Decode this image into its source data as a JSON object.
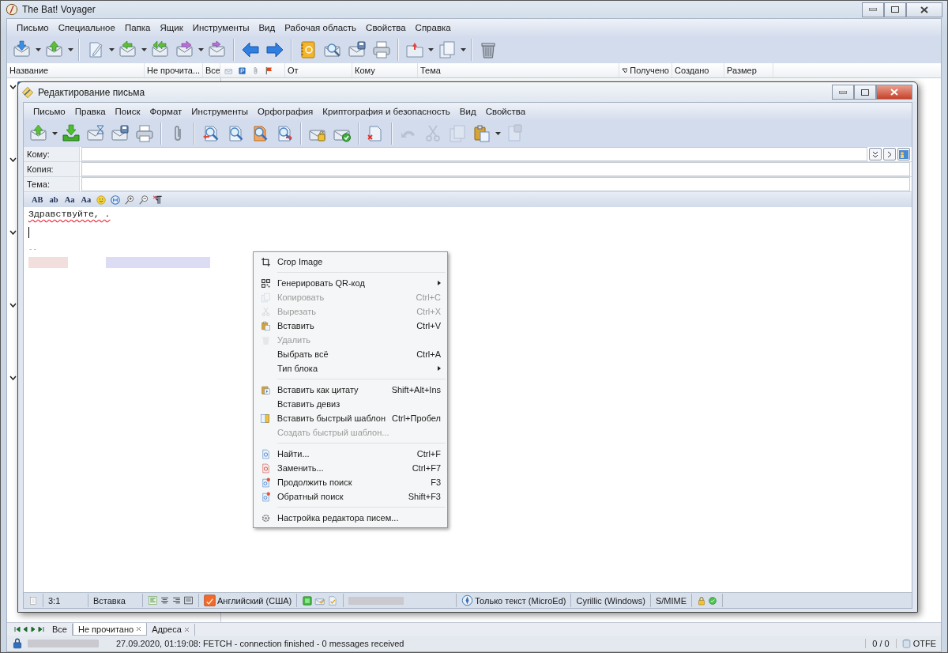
{
  "main_window": {
    "title": "The Bat! Voyager",
    "menu": [
      "Письмо",
      "Специальное",
      "Папка",
      "Ящик",
      "Инструменты",
      "Вид",
      "Рабочая область",
      "Свойства",
      "Справка"
    ],
    "pane_columns": [
      {
        "label": "Название"
      },
      {
        "label": "Не прочита..."
      },
      {
        "label": "Все"
      }
    ],
    "list_columns": [
      {
        "label": "От",
        "sorted": false
      },
      {
        "label": "Кому",
        "sorted": false
      },
      {
        "label": "Тема",
        "sorted": false
      },
      {
        "label": "Получено",
        "sorted": true
      },
      {
        "label": "Создано",
        "sorted": false
      },
      {
        "label": "Размер",
        "sorted": false
      }
    ],
    "tabs": [
      {
        "label": "Все",
        "selected": false,
        "closable": false
      },
      {
        "label": "Не прочитано",
        "selected": true,
        "closable": true
      },
      {
        "label": "Адреса",
        "selected": false,
        "closable": true
      }
    ],
    "status": {
      "message": "27.09.2020, 01:19:08: FETCH - connection finished - 0 messages received",
      "counter": "0 / 0",
      "mode": "OTFE"
    }
  },
  "editor": {
    "title": "Редактирование письма",
    "menu": [
      "Письмо",
      "Правка",
      "Поиск",
      "Формат",
      "Инструменты",
      "Орфография",
      "Криптография и безопасность",
      "Вид",
      "Свойства"
    ],
    "toolbar": [
      {
        "disabled": false
      },
      {
        "disabled": false
      },
      {
        "disabled": false
      },
      {
        "disabled": false
      },
      {
        "disabled": false
      },
      {
        "disabled": false
      },
      {
        "disabled": false
      },
      {
        "disabled": false
      },
      {
        "disabled": false
      },
      {
        "disabled": false
      },
      {
        "disabled": false
      },
      {
        "disabled": false
      },
      {
        "disabled": false
      },
      {
        "disabled": true
      },
      {
        "disabled": true
      },
      {
        "disabled": true
      },
      {
        "disabled": false
      },
      {
        "disabled": true
      }
    ],
    "fields": [
      {
        "label": "Кому:"
      },
      {
        "label": "Копия:"
      },
      {
        "label": "Тема:"
      }
    ],
    "format_buttons": [
      "AB",
      "ab",
      "Aa",
      "Aa"
    ],
    "body": {
      "greeting": "Здравствуйте, .",
      "signature_separator": "--"
    },
    "status": {
      "position": "3:1",
      "mode": "Вставка",
      "language": "Английский (США)",
      "editor_type": "Только текст (MicroEd)",
      "charset": "Cyrillic (Windows)",
      "security": "S/MIME"
    }
  },
  "context_menu": [
    {
      "kind": "item",
      "label": "Crop Image",
      "disabled": false,
      "submenu": false
    },
    {
      "kind": "separator"
    },
    {
      "kind": "item",
      "label": "Генерировать QR-код",
      "disabled": false,
      "submenu": true
    },
    {
      "kind": "item",
      "label": "Копировать",
      "shortcut": "Ctrl+C",
      "disabled": true,
      "submenu": false
    },
    {
      "kind": "item",
      "label": "Вырезать",
      "shortcut": "Ctrl+X",
      "disabled": true,
      "submenu": false
    },
    {
      "kind": "item",
      "label": "Вставить",
      "shortcut": "Ctrl+V",
      "disabled": false,
      "submenu": false
    },
    {
      "kind": "item",
      "label": "Удалить",
      "disabled": true,
      "submenu": false
    },
    {
      "kind": "item",
      "label": "Выбрать всё",
      "shortcut": "Ctrl+A",
      "disabled": false,
      "submenu": false
    },
    {
      "kind": "item",
      "label": "Тип блока",
      "disabled": false,
      "submenu": true
    },
    {
      "kind": "separator"
    },
    {
      "kind": "item",
      "label": "Вставить как цитату",
      "shortcut": "Shift+Alt+Ins",
      "disabled": false,
      "submenu": false
    },
    {
      "kind": "item",
      "label": "Вставить девиз",
      "disabled": false,
      "submenu": false
    },
    {
      "kind": "item",
      "label": "Вставить быстрый шаблон",
      "shortcut": "Ctrl+Пробел",
      "disabled": false,
      "submenu": false
    },
    {
      "kind": "item",
      "label": "Создать быстрый шаблон...",
      "disabled": true,
      "submenu": false
    },
    {
      "kind": "separator"
    },
    {
      "kind": "item",
      "label": "Найти...",
      "shortcut": "Ctrl+F",
      "disabled": false,
      "submenu": false
    },
    {
      "kind": "item",
      "label": "Заменить...",
      "shortcut": "Ctrl+F7",
      "disabled": false,
      "submenu": false
    },
    {
      "kind": "item",
      "label": "Продолжить поиск",
      "shortcut": "F3",
      "disabled": false,
      "submenu": false
    },
    {
      "kind": "item",
      "label": "Обратный поиск",
      "shortcut": "Shift+F3",
      "disabled": false,
      "submenu": false
    },
    {
      "kind": "separator"
    },
    {
      "kind": "item",
      "label": "Настройка редактора писем...",
      "disabled": false,
      "submenu": false
    }
  ]
}
